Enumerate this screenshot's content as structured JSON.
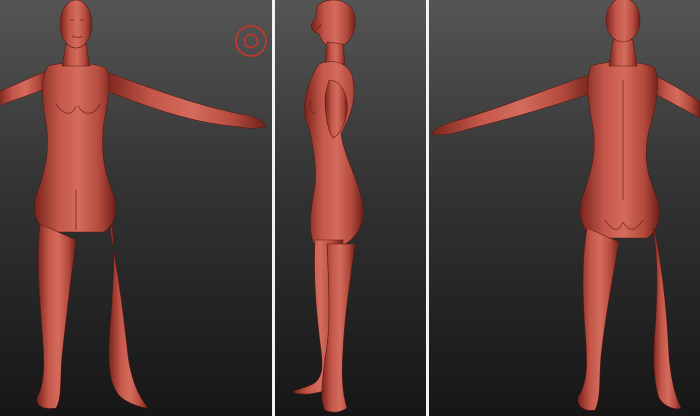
{
  "viewport": {
    "background_top": "#545454",
    "background_bottom": "#1b1b1b",
    "separator_color": "#f2f2f2"
  },
  "model": {
    "material_color": "#b6483a",
    "material_light": "#d56a5a",
    "material_dark": "#6e2018"
  },
  "views": [
    {
      "id": "front",
      "icon": "front-view"
    },
    {
      "id": "side",
      "icon": "side-view"
    },
    {
      "id": "back",
      "icon": "back-view"
    }
  ],
  "brush_cursor": {
    "icon": "brush-circle-icon",
    "color": "#c0392b"
  }
}
